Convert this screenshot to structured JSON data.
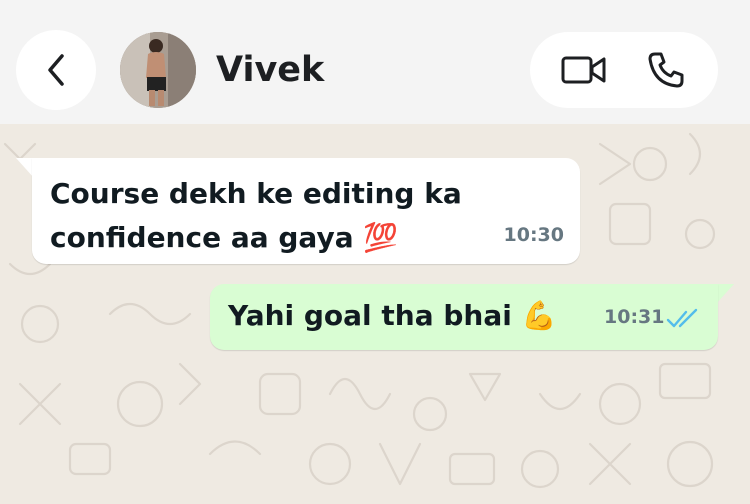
{
  "header": {
    "contact_name": "Vivek",
    "icons": {
      "back": "chevron-left-icon",
      "video": "video-call-icon",
      "phone": "phone-icon"
    }
  },
  "messages": [
    {
      "direction": "incoming",
      "line1": "Course dekh ke editing ka",
      "line2": "confidence aa gaya",
      "emoji": "💯",
      "time": "10:30"
    },
    {
      "direction": "outgoing",
      "text": "Yahi goal tha bhai",
      "emoji": "💪",
      "time": "10:31",
      "status": "read-double-tick"
    }
  ],
  "colors": {
    "header_bg": "#f4f4f4",
    "chat_bg": "#efeae2",
    "incoming_bubble": "#ffffff",
    "outgoing_bubble": "#d9fdd3",
    "read_tick": "#53bdeb",
    "timestamp": "#667781"
  }
}
